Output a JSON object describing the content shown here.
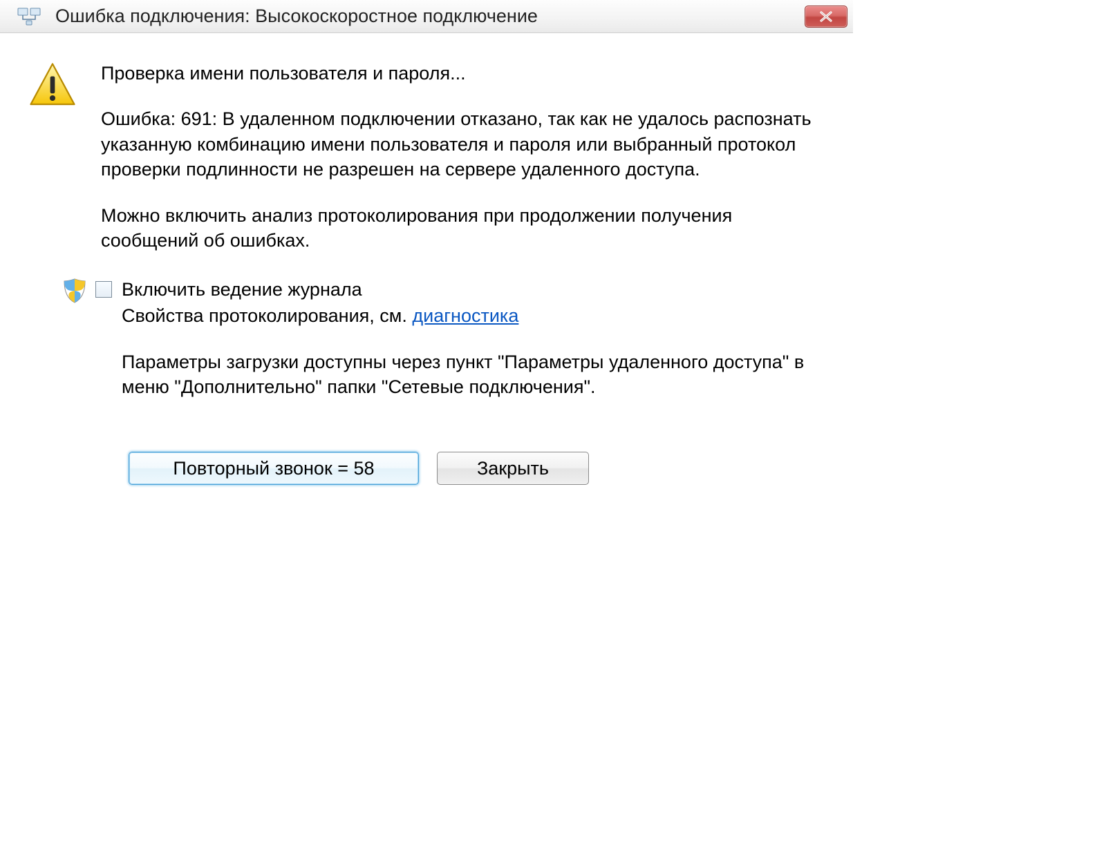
{
  "titlebar": {
    "title": "Ошибка подключения: Высокоскоростное подключение"
  },
  "body": {
    "checking_line": "Проверка имени пользователя и пароля...",
    "error_text": "Ошибка: 691: В удаленном подключении отказано, так как не удалось распознать указанную комбинацию имени пользователя и пароля или выбранный протокол проверки подлинности не разрешен на сервере удаленного доступа.",
    "logging_hint": "Можно включить анализ протоколирования при продолжении получения сообщений об ошибках.",
    "checkbox_label": "Включить ведение журнала",
    "logging_props_prefix": "Свойства протоколирования, см. ",
    "diagnostics_link": "диагностика",
    "params_text": "Параметры загрузки доступны через пункт \"Параметры удаленного доступа\" в меню \"Дополнительно\" папки \"Сетевые подключения\"."
  },
  "buttons": {
    "redial": "Повторный звонок = 58",
    "close": "Закрыть"
  }
}
